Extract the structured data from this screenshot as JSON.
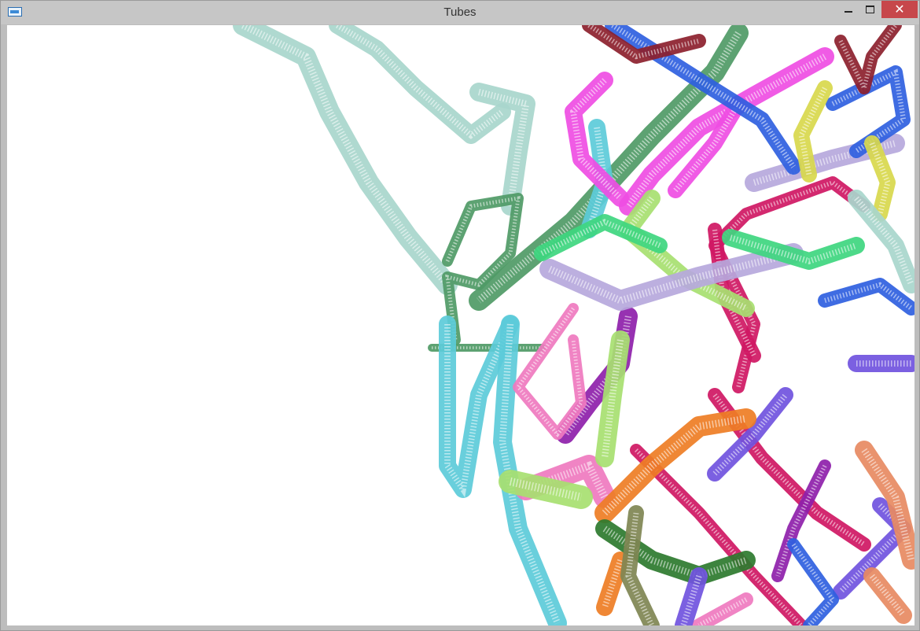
{
  "window": {
    "title": "Tubes",
    "controls": {
      "minimize_icon": "minimize-icon",
      "maximize_icon": "maximize-icon",
      "close_icon": "close-icon"
    }
  },
  "palette": {
    "mint": "#a8d6cc",
    "green": "#4f9a66",
    "bright_green": "#3ed67f",
    "cyan": "#5ccbd9",
    "magenta": "#ef4de3",
    "pink": "#ef79bf",
    "crimson": "#cf1763",
    "purple": "#8e1faa",
    "violet": "#7052de",
    "lavender": "#b6a8dc",
    "blue": "#2f5fe0",
    "lime": "#a7e070",
    "orange": "#ee7d24",
    "maroon": "#8c1f2c",
    "olive": "#7f8552",
    "yellow": "#d8d84c",
    "salmon": "#e78a62",
    "dark_green": "#2c7a2e"
  }
}
